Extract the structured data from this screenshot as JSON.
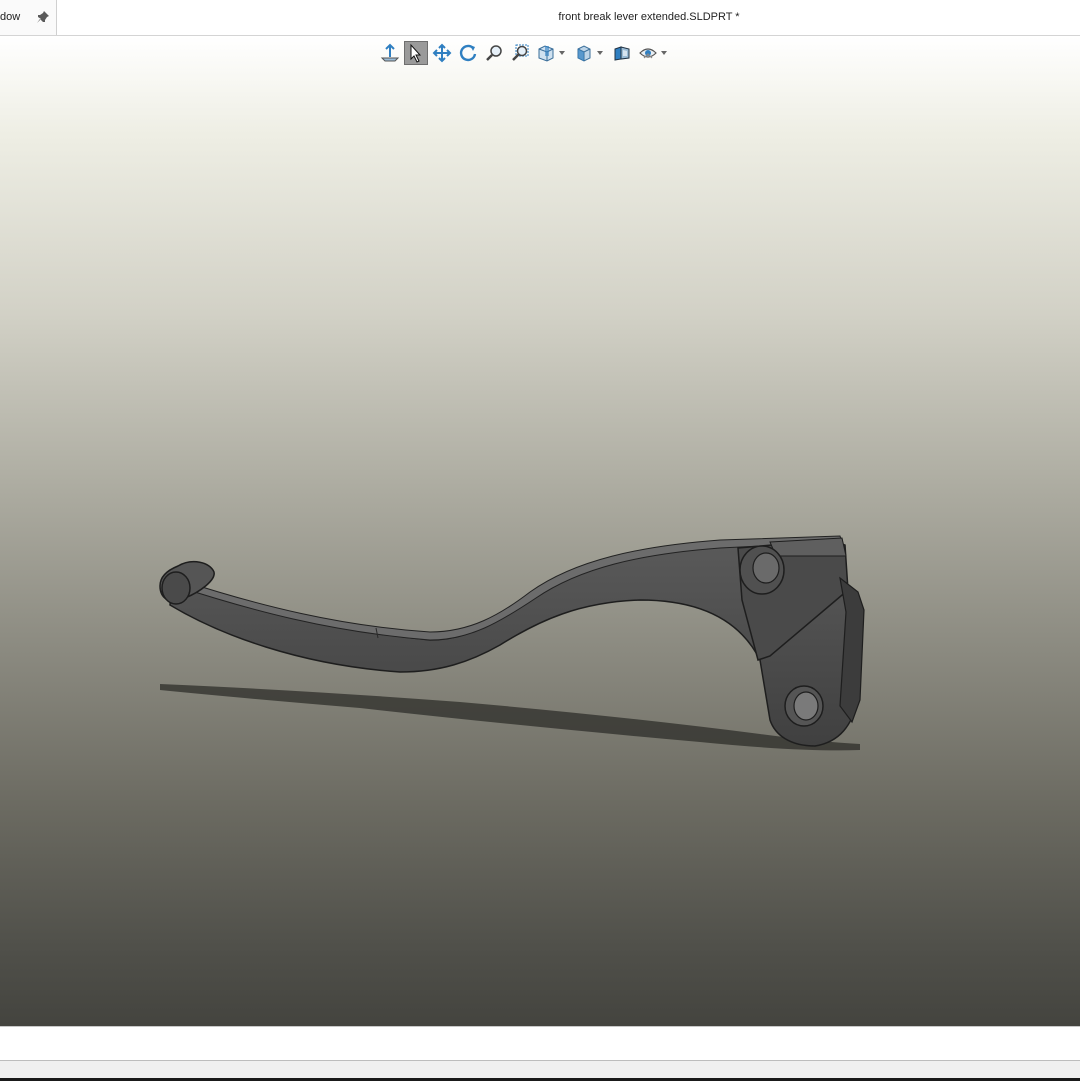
{
  "menu": {
    "fragment_label": "dow"
  },
  "titlebar": {
    "document_title": "front break lever extended.SLDPRT *"
  },
  "hud_toolbar": {
    "items": [
      {
        "icon": "normal-to-icon",
        "active": false
      },
      {
        "icon": "select-arrow-icon",
        "active": true
      },
      {
        "icon": "pan-icon",
        "active": false
      },
      {
        "icon": "rotate-icon",
        "active": false
      },
      {
        "icon": "zoom-to-fit-icon",
        "active": false
      },
      {
        "icon": "zoom-to-area-icon",
        "active": false
      },
      {
        "icon": "section-view-icon",
        "active": false,
        "dropdown": true
      },
      {
        "icon": "view-orientation-icon",
        "active": false,
        "dropdown": true
      },
      {
        "icon": "display-style-icon",
        "active": false
      },
      {
        "icon": "hide-show-items-icon",
        "active": false,
        "dropdown": true
      }
    ]
  },
  "model": {
    "name": "front break lever extended",
    "color": "#4e4e4e"
  },
  "colors": {
    "accent_blue": "#2f7fc1",
    "model_dark": "#3f3f3f"
  }
}
